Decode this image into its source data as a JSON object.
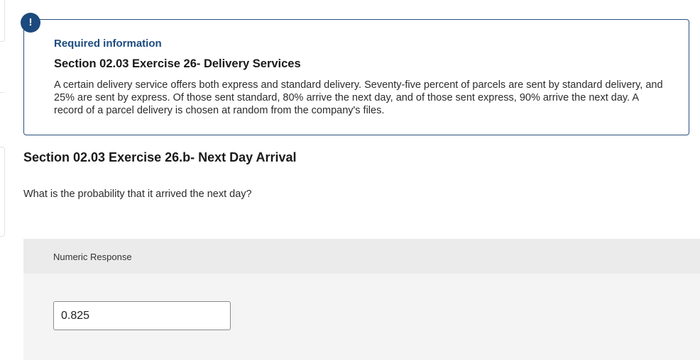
{
  "alert": {
    "icon": "exclamation-icon",
    "glyph": "!",
    "color": "#1c4a7e"
  },
  "info": {
    "required_label": "Required information",
    "section_title": "Section 02.03 Exercise 26- Delivery Services",
    "description": "A certain delivery service offers both express and standard delivery. Seventy-five percent of parcels are sent by standard delivery, and 25% are sent by express. Of those sent standard, 80% arrive the next day, and of those sent express, 90% arrive the next day. A record of a parcel delivery is chosen at random from the company's files."
  },
  "question": {
    "title": "Section 02.03 Exercise 26.b- Next Day Arrival",
    "prompt": "What is the probability that it arrived the next day?"
  },
  "response": {
    "label": "Numeric Response",
    "value": "0.825"
  }
}
